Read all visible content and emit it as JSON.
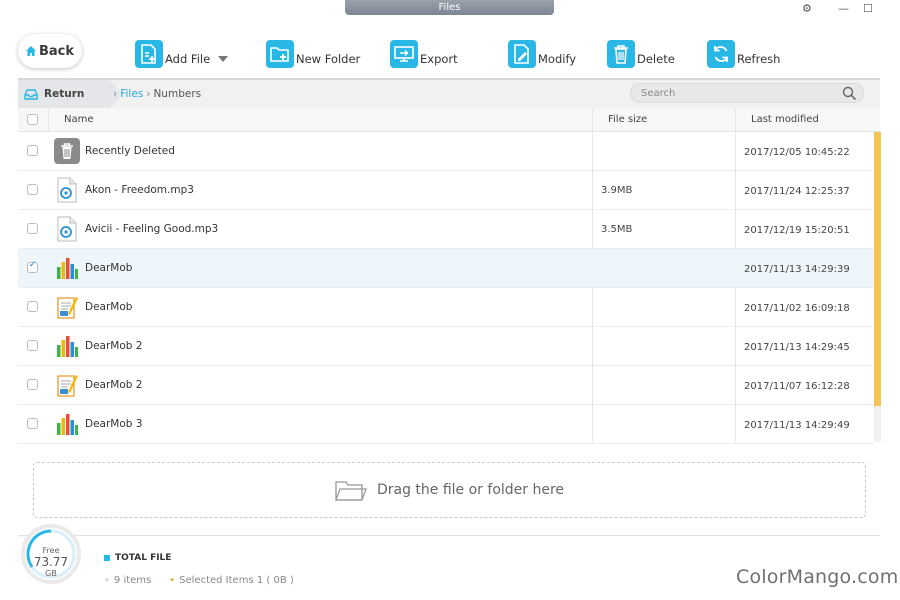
{
  "window": {
    "title": "Files"
  },
  "toolbar": {
    "back_label": "Back",
    "add_file_label": "Add File",
    "new_folder_label": "New Folder",
    "export_label": "Export",
    "modify_label": "Modify",
    "delete_label": "Delete",
    "refresh_label": "Refresh"
  },
  "breadcrumb": {
    "return_label": "Return",
    "items": [
      "Files",
      "Numbers"
    ]
  },
  "search": {
    "placeholder": "Search"
  },
  "table": {
    "headers": {
      "name": "Name",
      "size": "File size",
      "modified": "Last modified"
    },
    "rows": [
      {
        "name": "Recently Deleted",
        "size": "",
        "modified": "2017/12/05 10:45:22",
        "icon": "trash-icon",
        "selected": false
      },
      {
        "name": "Akon - Freedom.mp3",
        "size": "3.9MB",
        "modified": "2017/11/24 12:25:37",
        "icon": "audio-file-icon",
        "selected": false
      },
      {
        "name": "Avicii - Feeling Good.mp3",
        "size": "3.5MB",
        "modified": "2017/12/19 15:20:51",
        "icon": "audio-file-icon",
        "selected": false
      },
      {
        "name": "DearMob",
        "size": "",
        "modified": "2017/11/13 14:29:39",
        "icon": "numbers-icon",
        "selected": true
      },
      {
        "name": "DearMob",
        "size": "",
        "modified": "2017/11/02 16:09:18",
        "icon": "pages-icon",
        "selected": false
      },
      {
        "name": "DearMob 2",
        "size": "",
        "modified": "2017/11/13 14:29:45",
        "icon": "numbers-icon",
        "selected": false
      },
      {
        "name": "DearMob 2",
        "size": "",
        "modified": "2017/11/07 16:12:28",
        "icon": "pages-icon",
        "selected": false
      },
      {
        "name": "DearMob 3",
        "size": "",
        "modified": "2017/11/13 14:29:49",
        "icon": "numbers-icon",
        "selected": false
      }
    ]
  },
  "dropzone": {
    "label": "Drag the file or folder here"
  },
  "storage": {
    "free_label": "Free",
    "free_value": "73.77",
    "unit": "GB"
  },
  "summary": {
    "title": "TOTAL FILE",
    "items_count": "9 items",
    "selected": "Selected Items 1 ( 0B )"
  },
  "watermark": "ColorMango.com",
  "colors": {
    "accent": "#29b7e6",
    "scroll_thumb": "#f5c451",
    "link": "#2aa3d8"
  }
}
